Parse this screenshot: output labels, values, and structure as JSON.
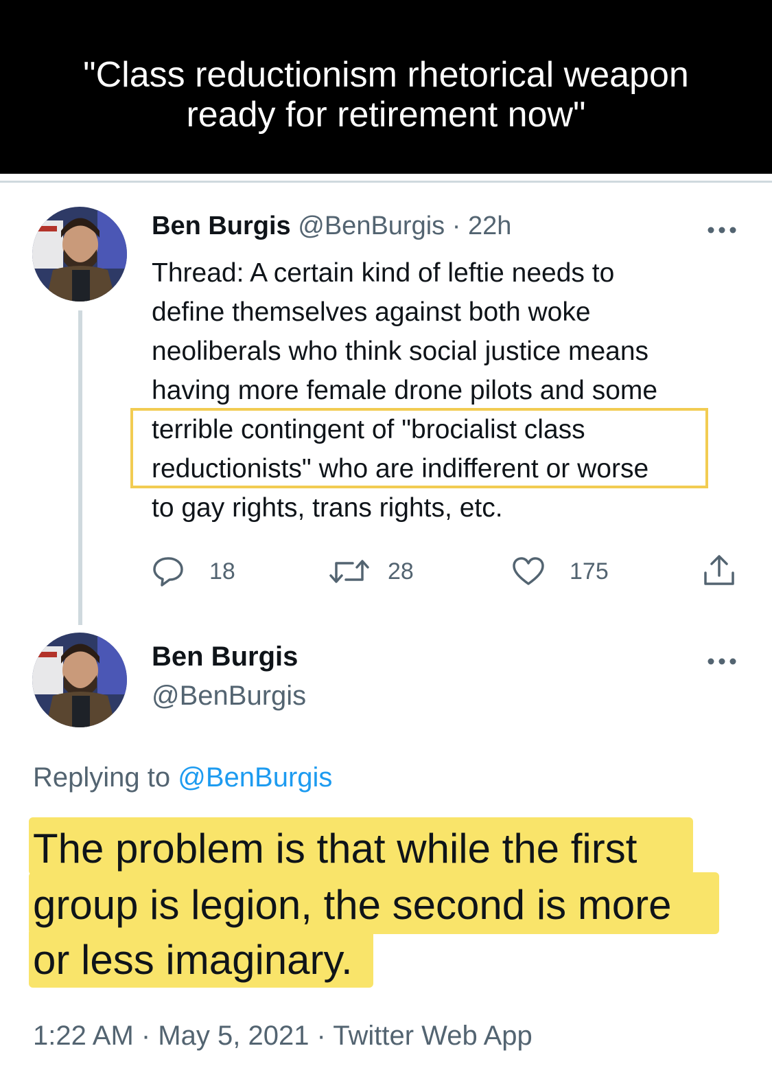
{
  "caption": {
    "line1": "\"Class reductionism rhetorical weapon",
    "line2": "ready for retirement now\""
  },
  "first_tweet": {
    "author_name": "Ben Burgis",
    "handle": "@BenBurgis",
    "time": "· 22h",
    "text_lines": [
      "Thread: A certain kind of leftie needs to",
      "define themselves against both woke",
      "neoliberals who think social justice means",
      "having more female drone pilots and some",
      "terrible contingent of \"brocialist class",
      "reductionists\" who are indifferent or worse",
      "to gay rights, trans rights, etc."
    ],
    "replies": "18",
    "retweets": "28",
    "likes": "175",
    "highlight_color": "#f2cc52"
  },
  "second_tweet": {
    "author_name": "Ben Burgis",
    "handle": "@BenBurgis",
    "replying_prefix": "Replying to",
    "replying_handle": "@BenBurgis",
    "text_lines": [
      "The problem is that while the first",
      "group is legion, the second is more",
      "or less imaginary."
    ],
    "timestamp": "1:22 AM · May 5, 2021 · Twitter Web App",
    "highlight_color": "#f9e46a"
  },
  "colors": {
    "link": "#1d9bf0",
    "muted": "#536471",
    "banner": "#000000"
  }
}
